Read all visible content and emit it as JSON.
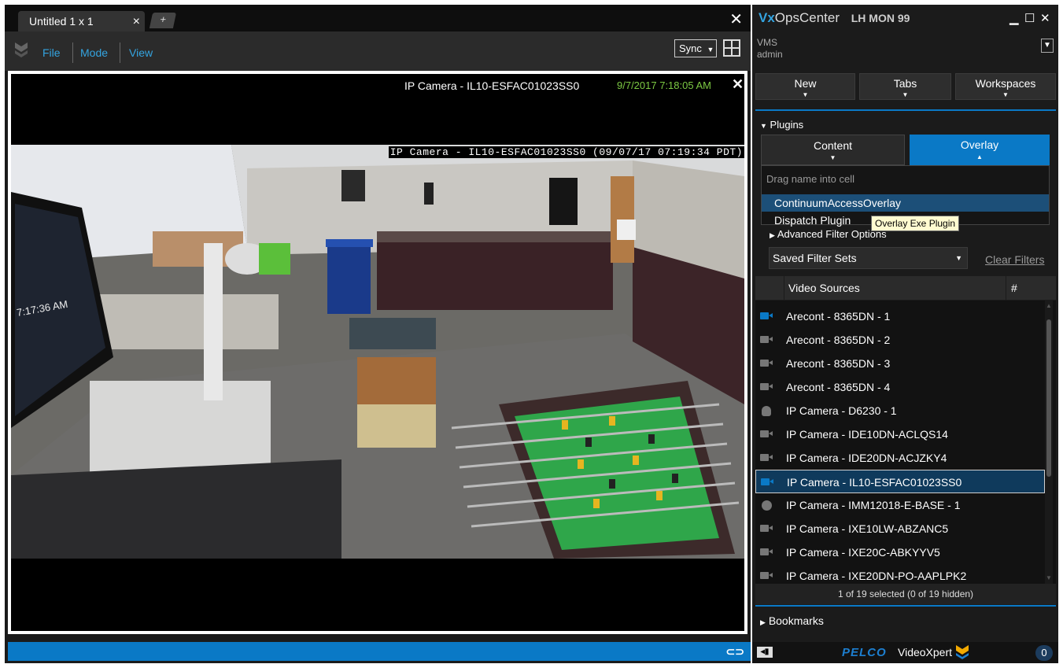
{
  "workspace": {
    "tab_label": "Untitled 1 x 1",
    "tab_close": "×",
    "add_tab": "+",
    "window_close": "✕",
    "menu": [
      "File",
      "Mode",
      "View"
    ],
    "sync_label": "Sync"
  },
  "cell": {
    "camera_title": "IP Camera - IL10-ESFAC01023SS0",
    "timestamp": "9/7/2017 7:18:05 AM",
    "close": "✕",
    "osd_text": "IP Camera - IL10-ESFAC01023SS0 (09/07/17 07:19:34 PDT)",
    "clock_on_wall": "7:17:36 AM"
  },
  "app": {
    "brand_vx": "Vx",
    "brand_rest": "OpsCenter",
    "monitor": "LH MON 99",
    "vms_label": "VMS",
    "user": "admin"
  },
  "top_buttons": [
    "New",
    "Tabs",
    "Workspaces"
  ],
  "plugins": {
    "heading": "Plugins",
    "tabs": [
      "Content",
      "Overlay"
    ],
    "active_tab": "Overlay",
    "hint": "Drag name into cell",
    "items": [
      "ContinuumAccessOverlay",
      "Dispatch Plugin"
    ],
    "selected": "ContinuumAccessOverlay",
    "tooltip": "Overlay Exe Plugin"
  },
  "filters": {
    "advanced_label": "Advanced Filter Options",
    "saved_sets": "Saved Filter Sets",
    "clear": "Clear Filters"
  },
  "video_sources": {
    "header": "Video Sources",
    "count_header": "#",
    "rows": [
      {
        "name": "Arecont - 8365DN - 1",
        "icon": "camera-icon",
        "active": true
      },
      {
        "name": "Arecont - 8365DN - 2",
        "icon": "camera-icon",
        "active": false
      },
      {
        "name": "Arecont - 8365DN - 3",
        "icon": "camera-icon",
        "active": false
      },
      {
        "name": "Arecont - 8365DN - 4",
        "icon": "camera-icon",
        "active": false
      },
      {
        "name": "IP Camera - D6230 - 1",
        "icon": "dome-camera-icon",
        "active": false
      },
      {
        "name": "IP Camera - IDE10DN-ACLQS14",
        "icon": "camera-icon",
        "active": false
      },
      {
        "name": "IP Camera - IDE20DN-ACJZKY4",
        "icon": "camera-icon",
        "active": false
      },
      {
        "name": "IP Camera - IL10-ESFAC01023SS0",
        "icon": "camera-icon",
        "active": true
      },
      {
        "name": "IP Camera - IMM12018-E-BASE - 1",
        "icon": "fisheye-camera-icon",
        "active": false
      },
      {
        "name": "IP Camera - IXE10LW-ABZANC5",
        "icon": "camera-icon",
        "active": false
      },
      {
        "name": "IP Camera - IXE20C-ABKYYV5",
        "icon": "camera-icon",
        "active": false
      },
      {
        "name": "IP Camera - IXE20DN-PO-AAPLPK2",
        "icon": "camera-icon",
        "active": false
      }
    ],
    "selected_index": 7,
    "footer": "1 of 19 selected (0 of 19 hidden)"
  },
  "bookmarks_label": "Bookmarks",
  "footer_brand": {
    "pelco": "PELCO",
    "product": "VideoXpert",
    "notifications": "0"
  },
  "colors": {
    "accent": "#0a79c6",
    "link": "#34a4e0",
    "timestamp": "#7cc943",
    "selection": "#0f3a5c",
    "panel": "#1b1b1b"
  }
}
